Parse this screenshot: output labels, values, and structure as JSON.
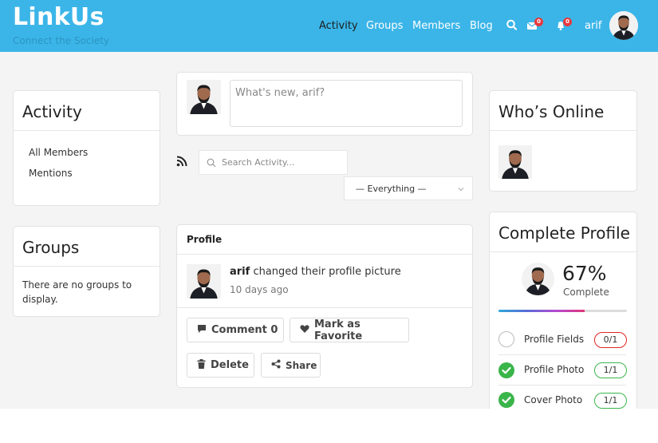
{
  "header": {
    "logo": "LinkUs",
    "tagline": "Connect the Society",
    "nav": [
      "Activity",
      "Groups",
      "Members",
      "Blog"
    ],
    "active_nav": "Activity",
    "messages_badge": "0",
    "notifications_badge": "0",
    "user_name": "arif"
  },
  "activity_widget": {
    "title": "Activity",
    "links": [
      "All Members",
      "Mentions"
    ]
  },
  "groups_widget": {
    "title": "Groups",
    "empty_text": "There are no groups to display."
  },
  "post_box": {
    "placeholder": "What's new, arif?"
  },
  "filters": {
    "search_placeholder": "Search Activity...",
    "select_value": "— Everything —"
  },
  "activity_item": {
    "heading": "Profile",
    "user": "arif",
    "action": "changed their profile picture",
    "time": "10 days ago",
    "comment_label": "Comment 0",
    "favorite_label": "Mark as Favorite",
    "delete_label": "Delete",
    "share_label": "Share"
  },
  "online_widget": {
    "title": "Who’s Online"
  },
  "profile_widget": {
    "title": "Complete Profile",
    "percent": "67%",
    "percent_value": 0.67,
    "complete_label": "Complete",
    "items": [
      {
        "label": "Profile Fields",
        "count": "0/1",
        "done": false
      },
      {
        "label": "Profile Photo",
        "count": "1/1",
        "done": true
      },
      {
        "label": "Cover Photo",
        "count": "1/1",
        "done": true
      }
    ]
  },
  "colors": {
    "header_bg": "#3bb5e8",
    "active_nav": "#1d1d1d",
    "badge": "#e8383d",
    "done_green": "#3ab54a",
    "pending_red": "#e02424"
  }
}
